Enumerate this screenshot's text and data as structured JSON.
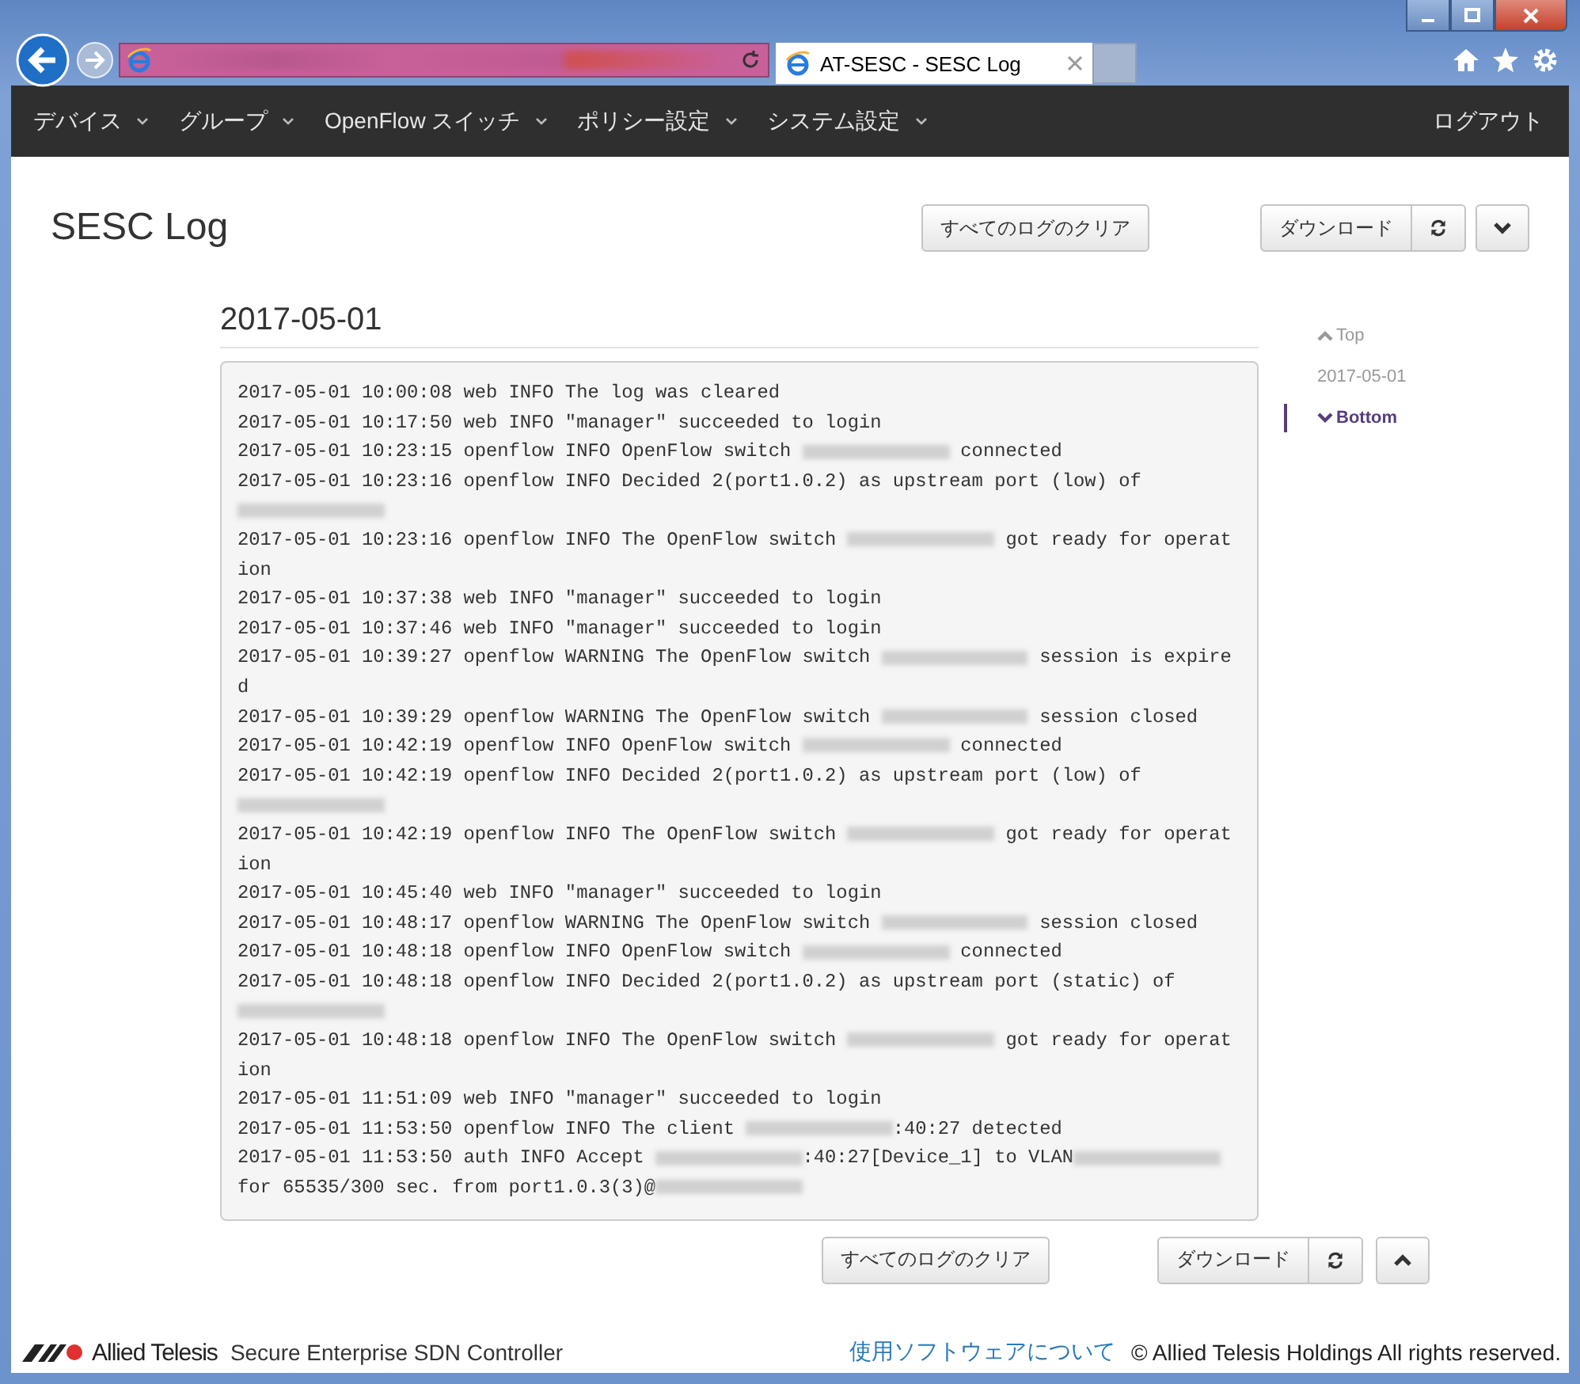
{
  "browser": {
    "tab_title": "AT-SESC - SESC Log"
  },
  "nav": {
    "items": [
      {
        "label": "デバイス"
      },
      {
        "label": "グループ"
      },
      {
        "label": "OpenFlow スイッチ"
      },
      {
        "label": "ポリシー設定"
      },
      {
        "label": "システム設定"
      }
    ],
    "logout": "ログアウト"
  },
  "page": {
    "title": "SESC Log",
    "clear_button": "すべてのログのクリア",
    "download_button": "ダウンロード"
  },
  "section": {
    "heading": "2017-05-01",
    "log": [
      [
        {
          "kind": "text",
          "text": "2017-05-01 10:00:08 web INFO The log was cleared"
        }
      ],
      [
        {
          "kind": "text",
          "text": "2017-05-01 10:17:50 web INFO \"manager\" succeeded to login"
        }
      ],
      [
        {
          "kind": "text",
          "text": "2017-05-01 10:23:15 openflow INFO OpenFlow switch "
        },
        {
          "kind": "redacted"
        },
        {
          "kind": "text",
          "text": " connected"
        }
      ],
      [
        {
          "kind": "text",
          "text": "2017-05-01 10:23:16 openflow INFO Decided 2(port1.0.2) as upstream port (low) of "
        },
        {
          "kind": "redacted"
        }
      ],
      [
        {
          "kind": "text",
          "text": "2017-05-01 10:23:16 openflow INFO The OpenFlow switch "
        },
        {
          "kind": "redacted"
        },
        {
          "kind": "text",
          "text": " got ready for operation"
        }
      ],
      [
        {
          "kind": "text",
          "text": "2017-05-01 10:37:38 web INFO \"manager\" succeeded to login"
        }
      ],
      [
        {
          "kind": "text",
          "text": "2017-05-01 10:37:46 web INFO \"manager\" succeeded to login"
        }
      ],
      [
        {
          "kind": "text",
          "text": "2017-05-01 10:39:27 openflow WARNING The OpenFlow switch "
        },
        {
          "kind": "redacted"
        },
        {
          "kind": "text",
          "text": " session is expired"
        }
      ],
      [
        {
          "kind": "text",
          "text": "2017-05-01 10:39:29 openflow WARNING The OpenFlow switch "
        },
        {
          "kind": "redacted"
        },
        {
          "kind": "text",
          "text": " session closed"
        }
      ],
      [
        {
          "kind": "text",
          "text": "2017-05-01 10:42:19 openflow INFO OpenFlow switch "
        },
        {
          "kind": "redacted"
        },
        {
          "kind": "text",
          "text": " connected"
        }
      ],
      [
        {
          "kind": "text",
          "text": "2017-05-01 10:42:19 openflow INFO Decided 2(port1.0.2) as upstream port (low) of "
        },
        {
          "kind": "redacted"
        }
      ],
      [
        {
          "kind": "text",
          "text": "2017-05-01 10:42:19 openflow INFO The OpenFlow switch "
        },
        {
          "kind": "redacted"
        },
        {
          "kind": "text",
          "text": " got ready for operation"
        }
      ],
      [
        {
          "kind": "text",
          "text": "2017-05-01 10:45:40 web INFO \"manager\" succeeded to login"
        }
      ],
      [
        {
          "kind": "text",
          "text": "2017-05-01 10:48:17 openflow WARNING The OpenFlow switch "
        },
        {
          "kind": "redacted"
        },
        {
          "kind": "text",
          "text": " session closed"
        }
      ],
      [
        {
          "kind": "text",
          "text": "2017-05-01 10:48:18 openflow INFO OpenFlow switch "
        },
        {
          "kind": "redacted"
        },
        {
          "kind": "text",
          "text": " connected"
        }
      ],
      [
        {
          "kind": "text",
          "text": "2017-05-01 10:48:18 openflow INFO Decided 2(port1.0.2) as upstream port (static) of "
        },
        {
          "kind": "redacted"
        }
      ],
      [
        {
          "kind": "text",
          "text": "2017-05-01 10:48:18 openflow INFO The OpenFlow switch "
        },
        {
          "kind": "redacted"
        },
        {
          "kind": "text",
          "text": " got ready for operation"
        }
      ],
      [
        {
          "kind": "text",
          "text": "2017-05-01 11:51:09 web INFO \"manager\" succeeded to login"
        }
      ],
      [
        {
          "kind": "text",
          "text": "2017-05-01 11:53:50 openflow INFO The client "
        },
        {
          "kind": "redacted"
        },
        {
          "kind": "text",
          "text": ":40:27 detected"
        }
      ],
      [
        {
          "kind": "text",
          "text": "2017-05-01 11:53:50 auth INFO Accept "
        },
        {
          "kind": "redacted"
        },
        {
          "kind": "text",
          "text": ":40:27[Device_1] to VLAN"
        },
        {
          "kind": "redacted"
        },
        {
          "kind": "text",
          "text": " for 65535/300 sec. from port1.0.3(3)@"
        },
        {
          "kind": "redacted"
        }
      ]
    ]
  },
  "side_nav": [
    {
      "label": "Top",
      "kind": "up",
      "selected": false
    },
    {
      "label": "2017-05-01",
      "kind": "plain",
      "selected": false
    },
    {
      "label": "Bottom",
      "kind": "down",
      "selected": true
    }
  ],
  "bottom": {
    "clear_button": "すべてのログのクリア",
    "download_button": "ダウンロード"
  },
  "footer": {
    "brand": "Allied Telesis",
    "product": "Secure Enterprise SDN Controller",
    "link": "使用ソフトウェアについて",
    "copyright": "© Allied Telesis Holdings All rights reserved."
  }
}
